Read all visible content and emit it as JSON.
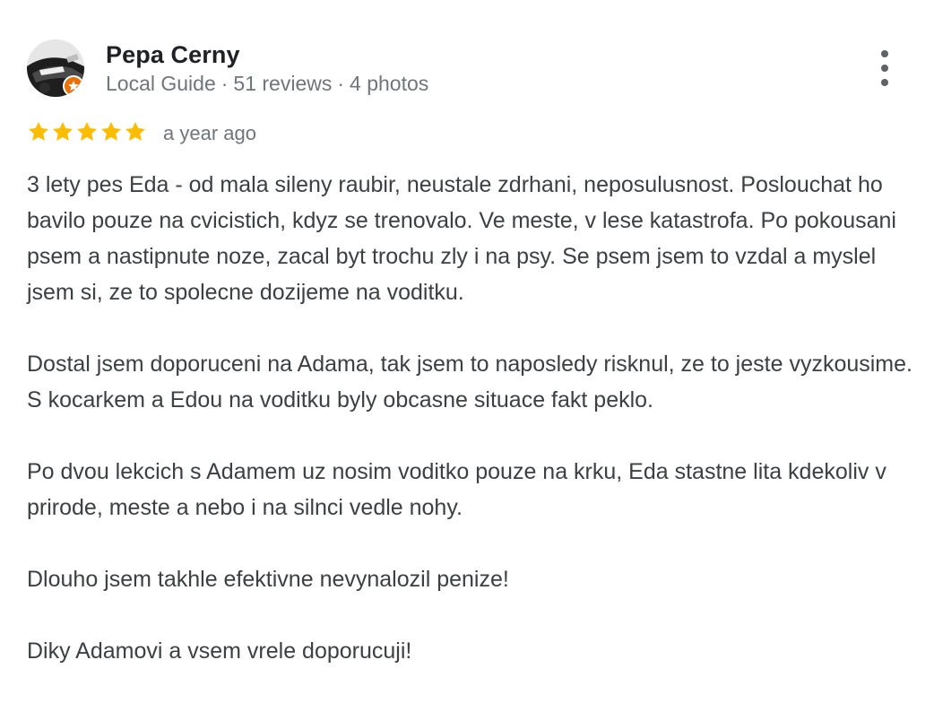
{
  "author": {
    "name": "Pepa Cerny",
    "role": "Local Guide",
    "separator": "·",
    "reviews": "51 reviews",
    "photos": "4 photos",
    "avatar_icon": "profile-photo",
    "badge_icon": "local-guide-star-icon",
    "badge_color": "#e8710a"
  },
  "rating": {
    "stars": 5,
    "max": 5,
    "star_color": "#fbbc04",
    "date": "a year ago"
  },
  "review": {
    "paragraphs": [
      "3 lety pes Eda - od mala sileny raubir, neustale zdrhani, neposulusnost. Poslouchat ho bavilo pouze na cvicistich, kdyz se trenovalo. Ve meste, v lese katastrofa. Po pokousani psem a nastipnute noze, zacal byt trochu zly i na psy. Se psem jsem to vzdal a myslel jsem si, ze to spolecne dozijeme na voditku.",
      "Dostal jsem doporuceni na Adama, tak jsem to naposledy risknul, ze to jeste vyzkousime. S kocarkem a Edou na voditku byly obcasne situace fakt peklo.",
      "Po dvou lekcich s Adamem uz nosim voditko pouze na krku, Eda stastne lita kdekoliv v prirode, meste a nebo i na silnci vedle nohy.",
      "Dlouho jsem takhle efektivne nevynalozil penize!",
      "Diky Adamovi a vsem vrele doporucuji!"
    ]
  },
  "menu": {
    "icon": "more-vert-icon"
  }
}
